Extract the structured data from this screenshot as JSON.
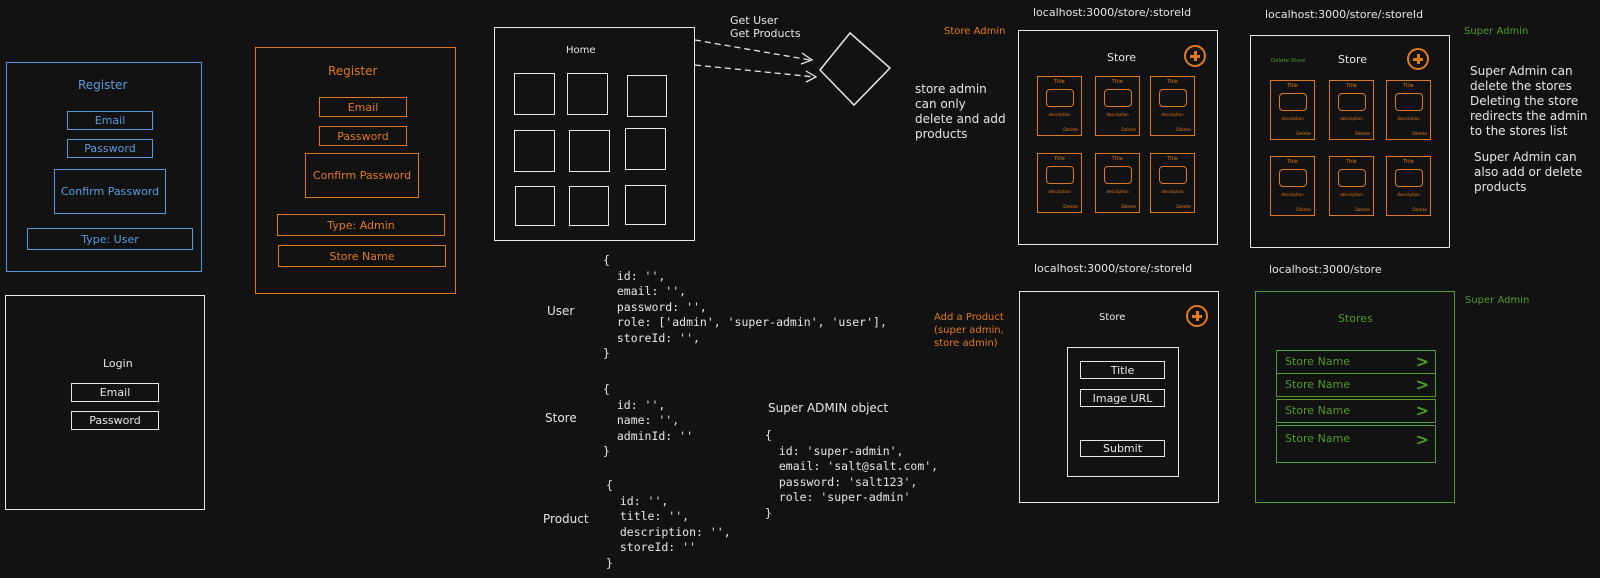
{
  "register_user": {
    "title": "Register",
    "email": "Email",
    "password": "Password",
    "confirm": "Confirm Password",
    "type": "Type: User"
  },
  "register_admin": {
    "title": "Register",
    "email": "Email",
    "password": "Password",
    "confirm": "Confirm Password",
    "type": "Type: Admin",
    "store_name": "Store Name"
  },
  "login": {
    "title": "Login",
    "email": "Email",
    "password": "Password"
  },
  "home": {
    "title": "Home",
    "arrow_label": "Get User\nGet Products"
  },
  "models": {
    "user_label": "User",
    "user_code": "{\n  id: '',\n  email: '',\n  password: '',\n  role: ['admin', 'super-admin', 'user'],\n  storeId: '',\n}",
    "store_label": "Store",
    "store_code": "{\n  id: '',\n  name: '',\n  adminId: ''\n}",
    "product_label": "Product",
    "product_code": "{\n  id: '',\n  title: '',\n  description: '',\n  storeId: ''\n}",
    "super_title": "Super ADMIN object",
    "super_code": "{\n  id: 'super-admin',\n  email: 'salt@salt.com',\n  password: 'salt123',\n  role: 'super-admin'\n}"
  },
  "store_admin": {
    "url": "localhost:3000/store/:storeId",
    "role_label": "Store Admin",
    "note": "store admin\ncan only\ndelete and add\nproducts",
    "title": "Store",
    "card_title": "Title",
    "card_desc": "description",
    "card_delete": "Delete"
  },
  "super_store": {
    "url": "localhost:3000/store/:storeId",
    "role_label": "Super Admin",
    "delete_store": "Delete Store",
    "title": "Store",
    "note1": "Super Admin can\ndelete the stores\nDeleting the store\nredirects the admin\nto the stores list",
    "note2": "Super Admin can\nalso add or delete\nproducts"
  },
  "add_product": {
    "url": "localhost:3000/store/:storeId",
    "label": "Add a Product\n(super admin,\nstore admin)",
    "title": "Store",
    "field_title": "Title",
    "field_image": "Image URL",
    "submit": "Submit"
  },
  "stores_list": {
    "url": "localhost:3000/store",
    "role_label": "Super Admin",
    "title": "Stores",
    "items": [
      "Store Name",
      "Store Name",
      "Store Name",
      "Store Name"
    ]
  },
  "colors": {
    "blue": "#5b9bdc",
    "orange": "#e07a1f",
    "white": "#e6e6e6",
    "green": "#4f9a2a",
    "background": "#121212"
  }
}
